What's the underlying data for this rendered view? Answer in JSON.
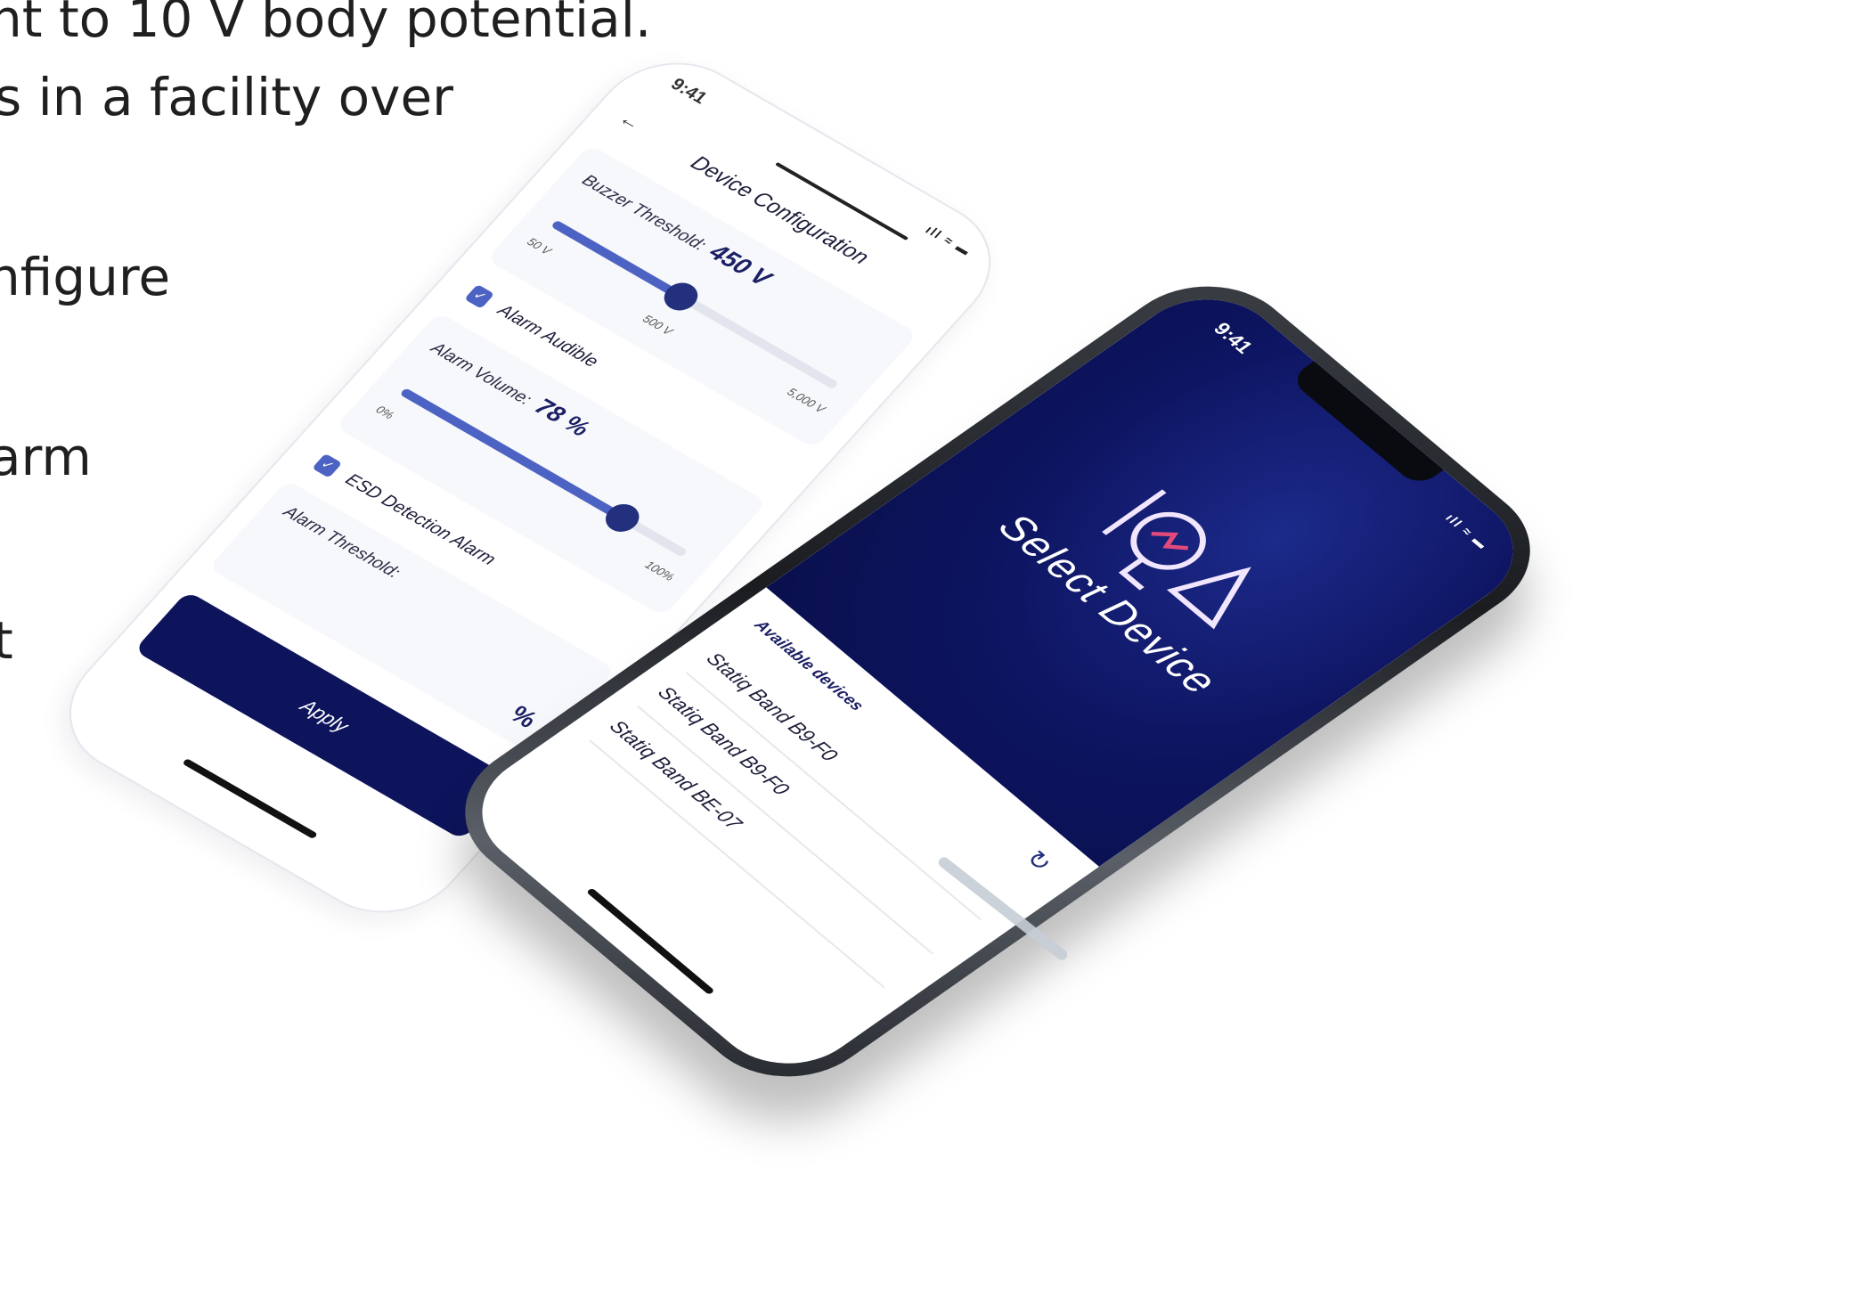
{
  "background_text": {
    "line1": "nt to 10 V body potential.",
    "line2": "s in a facility over",
    "line3": "nfigure",
    "line4": "arm",
    "line5": "t"
  },
  "config_screen": {
    "status_time": "9:41",
    "status_icons": "ıll ≈ ▬",
    "back_icon": "←",
    "title": "Device Configuration",
    "buzzer": {
      "label": "Buzzer Threshold:",
      "value": "450 V",
      "min_label": "50 V",
      "mid_label": "500 V",
      "max_label": "5,000 V",
      "level": 0.45
    },
    "alarm_audible": {
      "checked": true,
      "label": "Alarm Audible"
    },
    "volume": {
      "label": "Alarm Volume:",
      "value": "78 %",
      "min_label": "0%",
      "max_label": "100%",
      "level": 0.78
    },
    "esd_alarm": {
      "checked": true,
      "label": "ESD Detection Alarm"
    },
    "alarm_threshold": {
      "label": "Alarm Threshold:",
      "unit": "%"
    },
    "apply_label": "Apply"
  },
  "phone_screen": {
    "status_time": "9:41",
    "status_icons": "ıll ≈ ▬",
    "title": "Select Device",
    "available_label": "Available devices",
    "devices": [
      "Statiq Band B9-F0",
      "Statiq Band B9-F0",
      "Statiq Band BE-07"
    ]
  },
  "colors": {
    "navy": "#0e145c",
    "accent": "#4d63c4",
    "knob": "#23307e"
  }
}
